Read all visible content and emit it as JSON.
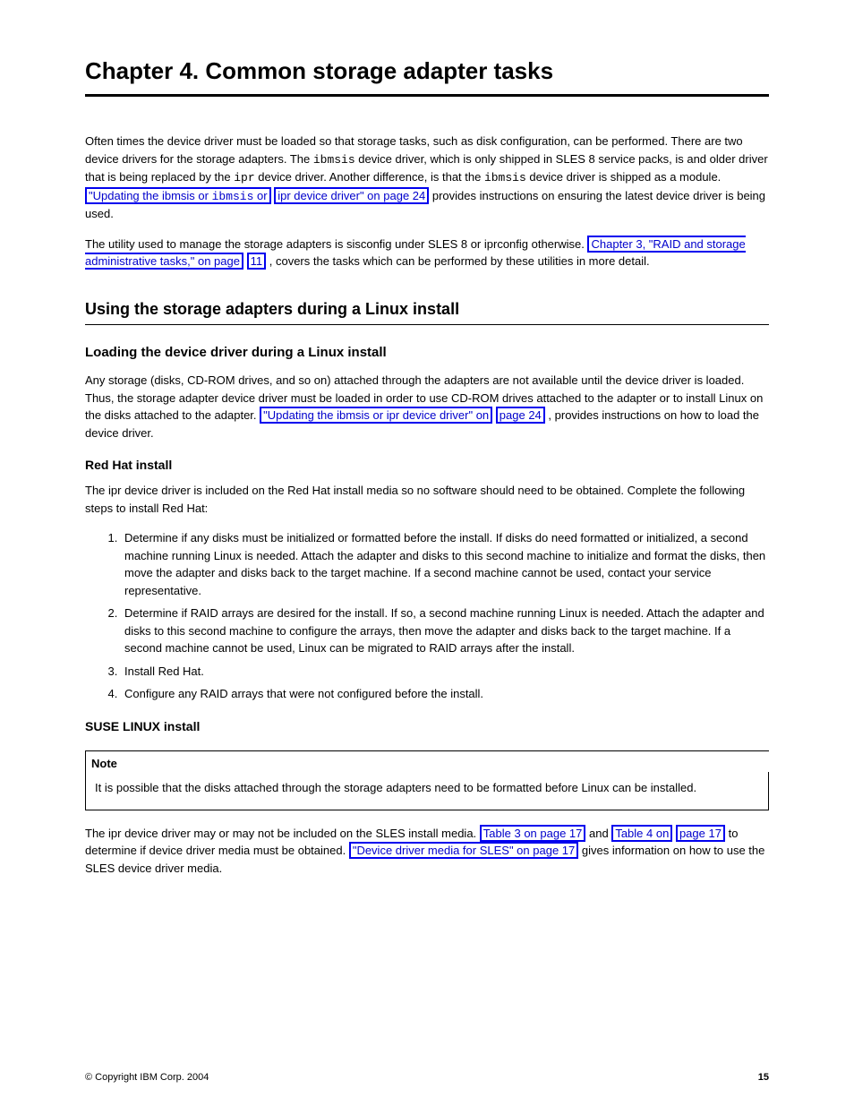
{
  "chapter_title": "Chapter 4. Common storage adapter tasks",
  "intro": {
    "p1_a": "Often times the device driver must be loaded so that storage tasks, such as disk configuration, can be performed. There are two device drivers for the storage adapters. The ",
    "p1_b": " device driver, which is only shipped in SLES 8 service packs, is and older driver that is being replaced by the ",
    "p1_c": " device driver. Another difference, is that the ",
    "p1_d": " device driver is shipped as a module. ",
    "p1_link1": "\"Updating the ibmsis or",
    "p1_link2": "ipr device driver\" on page 24",
    "p1_e": " provides instructions on ensuring the latest device driver is being used.",
    "p2_a": "The utility used to manage the storage adapters is sisconfig under SLES 8 or iprconfig otherwise. ",
    "p2_link1": "Chapter 3, \"RAID and storage administrative tasks,\" on page",
    "p2_link2": "11",
    "p2_b": ", covers the tasks which can be performed by these utilities in more detail."
  },
  "sec1": {
    "title": "Using the storage adapters during a Linux install",
    "sub_title": "Loading the device driver during a Linux install",
    "p1_a": "Any storage (disks, CD-ROM drives, and so on) attached through the adapters are not available until the device driver is loaded. Thus, the storage adapter device driver must be loaded in order to use CD-ROM drives attached to the adapter or to install Linux on the disks attached to the adapter. ",
    "p1_link1": "\"Updating the ibmsis or ipr device driver\" on",
    "p1_link2": "page 24",
    "p1_b": ", provides instructions on how to load the device driver.",
    "rh_title": "Red Hat install",
    "rh_p1": "The ipr device driver is included on the Red Hat install media so no software should need to be obtained. Complete the following steps to install Red Hat:",
    "rh_steps": [
      "Determine if any disks must be initialized or formatted before the install. If disks do need formatted or initialized, a second machine running Linux is needed. Attach the adapter and disks to this second machine to initialize and format the disks, then move the adapter and disks back to the target machine. If a second machine cannot be used, contact your service representative.",
      "Determine if RAID arrays are desired for the install. If so, a second machine running Linux is needed. Attach the adapter and disks to this second machine to configure the arrays, then move the adapter and disks back to the target machine. If a second machine cannot be used, Linux can be migrated to RAID arrays after the install.",
      "Install Red Hat.",
      "Configure any RAID arrays that were not configured before the install."
    ],
    "sles_title": "SUSE LINUX install",
    "sles_note_label": "Note",
    "sles_note_body": "It is possible that the disks attached through the storage adapters need to be formatted before Linux can be installed.",
    "sles_p1_a": "The ipr device driver may or may not be included on the SLES install media. ",
    "sles_p1_link1": "Table 3 on page 17",
    "sles_p1_b": " and ",
    "sles_p1_link2": "Table 4 on",
    "sles_p1_link3": "page 17",
    "sles_p1_c": " to determine if device driver media must be obtained. ",
    "sles_p1_link4": "\"Device driver media for SLES\" on page 17",
    "sles_p1_d": " gives information on how to use the SLES device driver media."
  },
  "footer": {
    "copyright": "© Copyright IBM Corp. 2004",
    "page": "15"
  }
}
